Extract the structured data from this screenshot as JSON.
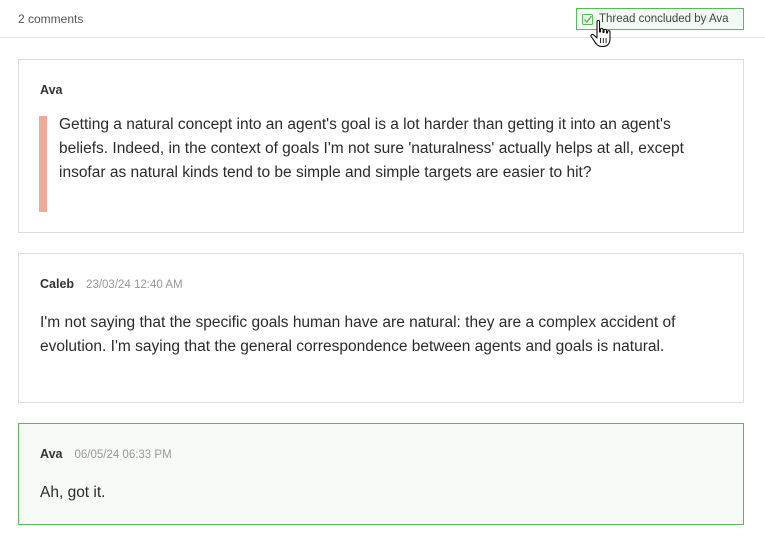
{
  "header": {
    "comment_count": "2 comments",
    "concluded_label": "Thread concluded by Ava",
    "concluded_icon": "checkbox-check-icon",
    "accent_color": "#5cb85c"
  },
  "comments": [
    {
      "author": "Ava",
      "timestamp": "",
      "quote": "Getting a natural concept into an agent's goal is a lot harder than getting it into an agent's beliefs. Indeed, in the context of goals I'm not sure 'naturalness' actually helps at all, except insofar as natural kinds tend to be simple and simple targets are easier to hit?",
      "quote_bar_color": "#f0ab97"
    },
    {
      "author": "Caleb",
      "timestamp": "23/03/24 12:40 AM",
      "text": "I'm not saying that the specific goals human have are natural: they are a complex accident of evolution. I'm saying that the general correspondence between agents and goals is natural."
    },
    {
      "author": "Ava",
      "timestamp": "06/05/24 06:33 PM",
      "text": "Ah, got it.",
      "highlight_color": "#5cb85c"
    }
  ],
  "cursor": "hand-pointer-icon"
}
